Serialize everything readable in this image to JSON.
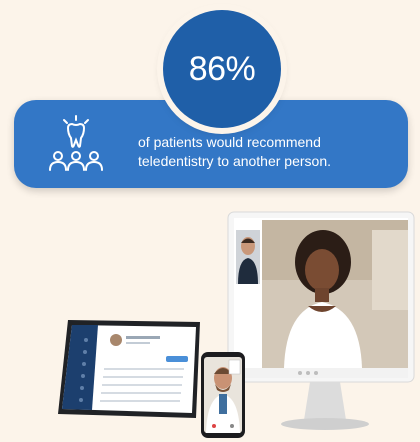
{
  "stat": {
    "value": "86%",
    "caption_line1": "of patients would recommend",
    "caption_line2": "teledentistry to another person."
  },
  "icons": {
    "banner_icon": "tooth-with-people-icon"
  },
  "colors": {
    "background": "#fcf4ea",
    "circle": "#1f5fa8",
    "banner": "#3377c6",
    "text": "#ffffff"
  }
}
